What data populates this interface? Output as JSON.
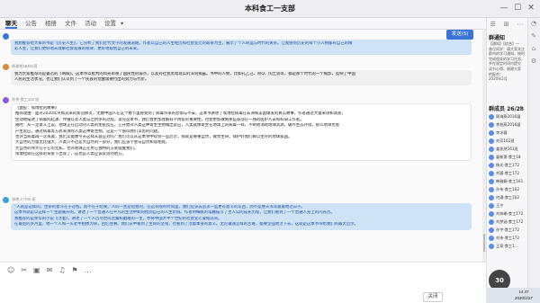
{
  "window": {
    "title": "本科食工一支部",
    "minimize": "—",
    "maximize": "☐",
    "close": "✕"
  },
  "tabs": [
    {
      "label": "聊天"
    },
    {
      "label": "公告"
    },
    {
      "label": "相册"
    },
    {
      "label": "文件"
    },
    {
      "label": "活动"
    },
    {
      "label": "设置"
    },
    {
      "label": "▾"
    }
  ],
  "messages": [
    {
      "sender": "",
      "style": "blue",
      "lines": [
        "我想推荐给大家的书是《历史人生》，它分析了我们近代文学的发展道路，作者以自己的人生经历和社会变迁的联系为主，展示了个人命运与时代的关系。让我感到历史的每个小人物都有自己的精",
        "彩人生，让我们更好地去理解社会发展的规律，更好地规划自己的未来。"
      ]
    },
    {
      "sender": "杨俊柏18401班",
      "style": "gray",
      "lines": [
        "我为大家推荐的是鲁迅的《呐喊》。这本书以批判的目光审视了国民性的弱点，以及对社会黑暗现实的深刻揭露。书中的人物，比如孔乙己、阿Q、闰土等等，都是那个时代的一个缩影，反映了中国",
        "人民的生活状况，也让我们认识到了一个民族的觉醒需要付出的努力与代价。"
      ]
    },
    {
      "sender": "孙伟 食工162 班",
      "style": "white",
      "lines": [
        "《血疫：埃博拉的故事》",
        "推荐理由：面对2020年突如其来的新冠肺炎，无数中国人在这个春节里感受到了病毒带来的恐惧与不安。这本书讲述了埃博拉病毒在非洲和美国爆发的真实故事，作者通过大量采访和调查，",
        "生动地描述了病毒的起源、传播以及人类与之抗争的过程。读完这本书，我们会更加理解科学防疫的重要性，也会更加敬佩那些奋战在一线的医护人员和科研工作者。",
        "随时：从一定意义上说，地球正在启动对人类的免疫反应。它开始对人类这种寄生生物做出反应，人类就像寄生在地球上的病毒一样，不断地消耗地球资源，破坏生态环境，那么地球也会",
        "产生反应，通过病毒等方式来清除人类这种寄生物。这是一个值得我们深思的问题。",
        "也许当病毒再一次来袭，我们又能像今天这样从容应对吗？我们可以从这本书中得到一些启示，那就是尊重自然，敬畏生命，保护好我们赖以生存的地球家园。",
        "大自然的力量无比强大，人类只不过是大自然的一部分，我们应该学会与自然和谐相处。",
        "大自然的伟大在于它的无私，也许地球正在用它独特的方式提醒我们。",
        "埃博拉就在这样的背景下出现了，这也是人类应该反思的地方。"
      ]
    },
    {
      "sender": "张晓 17702 班",
      "style": "blue",
      "lines": [
        "“人就是这样的，生命的意义在于过程，而不在于结果。”人的一生是短暂的，在这有限的时间里，我们应该去追求一些更有意义的东西，而不是整天浑浑噩噩地过日子。",
        "这本书就是以这样一个主题展开的，讲述了一个普通人在平凡的生活中如何找到自己的人生价值。作者用细腻的笔触描写了主人公的成长历程，让我们看到了一个普通人身上的闪光点。",
        "我推荐的是余华的小说《活着》，讲述了一个人历尽世间沧桑和磨难的一生，亦将中国大半个世纪的社会变迁凝缩其间。",
        "在最后的岁月里，他一个人和一头老牛相依为命，回忆往事。我们从中看到了生命的坚韧，也看到了活着本身的意义。无论遭遇怎样的苦难，都要坚强地活下去，这就是这本书带给我们的最大启示。"
      ]
    }
  ],
  "input": {
    "tools": [
      "☺",
      "✂",
      "▣",
      "✉",
      "♫",
      "⚑",
      "…"
    ],
    "close_label": "关闭",
    "send_label": "发送(S)",
    "send_arrow": "▾"
  },
  "sidebar": {
    "icons": [
      "☰",
      "⊞",
      "⋯"
    ],
    "notice_title": "群通知",
    "notice_lines": [
      "【通知】【综合】一",
      "各位同学：请大家关注",
      "群内的学习通知，按时",
      "完成相关的学习任务，",
      "并在规定时间内提交",
      "读书心得。谢谢大家",
      "的配合！",
      "",
      "2020年2月"
    ],
    "member_title": "群成员 26/28",
    "search_icon": "⌕",
    "members": [
      "周海燕2016届",
      "李旭燕2016届",
      "李冰蓉",
      "刘芳162班",
      "姜凯然161班",
      "翟新第·食工18",
      "杨光·食工172",
      "刘蓉·食工172",
      "韩雅娟·食工161",
      "孙伟·食工162",
      "何通·食工162",
      "王宁",
      "刘梓瑜·食工172",
      "刘梦涵·食工172",
      "孙宇·食工172",
      "刘伟·食工172",
      "王家·食工1..."
    ]
  },
  "rightbar": {
    "icons": [
      "◔",
      "✎",
      "⌂",
      "⚙"
    ]
  },
  "overlay": {
    "zoom": "30"
  },
  "clock": {
    "time": "14:47",
    "date": "2020/2/27"
  }
}
